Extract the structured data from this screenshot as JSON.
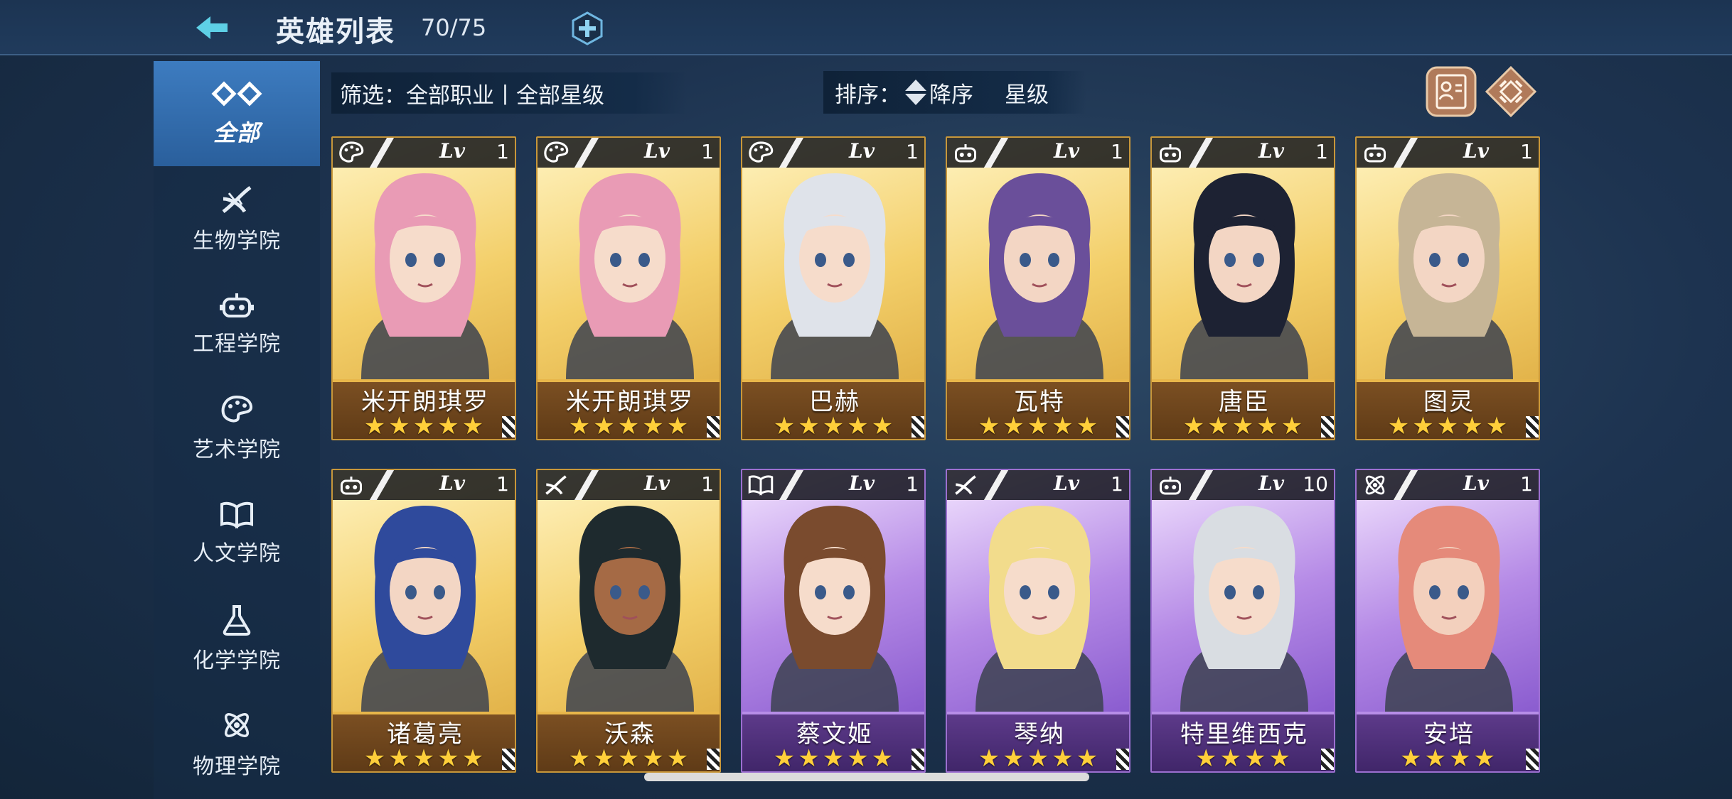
{
  "header": {
    "title": "英雄列表",
    "count": "70/75"
  },
  "sidebar": {
    "items": [
      {
        "label": "全部",
        "icon": "all-icon",
        "active": true
      },
      {
        "label": "生物学院",
        "icon": "dna-icon"
      },
      {
        "label": "工程学院",
        "icon": "robot-icon"
      },
      {
        "label": "艺术学院",
        "icon": "palette-icon"
      },
      {
        "label": "人文学院",
        "icon": "book-icon"
      },
      {
        "label": "化学学院",
        "icon": "flask-icon"
      },
      {
        "label": "物理学院",
        "icon": "atom-icon"
      }
    ]
  },
  "filter": {
    "text": "筛选：全部职业丨全部星级"
  },
  "sort": {
    "label": "排序：",
    "order": "降序",
    "field": "星级"
  },
  "lv_label": "Lv",
  "heroes": [
    {
      "name": "米开朗琪罗",
      "level": "1",
      "stars": "★★★★★",
      "stars_count": 5,
      "class_icon": "palette-icon",
      "rarity": "gold"
    },
    {
      "name": "米开朗琪罗",
      "level": "1",
      "stars": "★★★★★",
      "stars_count": 5,
      "class_icon": "palette-icon",
      "rarity": "gold"
    },
    {
      "name": "巴赫",
      "level": "1",
      "stars": "★★★★★",
      "stars_count": 5,
      "class_icon": "palette-icon",
      "rarity": "gold"
    },
    {
      "name": "瓦特",
      "level": "1",
      "stars": "★★★★★",
      "stars_count": 5,
      "class_icon": "robot-icon",
      "rarity": "gold"
    },
    {
      "name": "唐臣",
      "level": "1",
      "stars": "★★★★★",
      "stars_count": 5,
      "class_icon": "robot-icon",
      "rarity": "gold"
    },
    {
      "name": "图灵",
      "level": "1",
      "stars": "★★★★★",
      "stars_count": 5,
      "class_icon": "robot-icon",
      "rarity": "gold"
    },
    {
      "name": "诸葛亮",
      "level": "1",
      "stars": "★★★★★",
      "stars_count": 5,
      "class_icon": "robot-icon",
      "rarity": "gold"
    },
    {
      "name": "沃森",
      "level": "1",
      "stars": "★★★★★",
      "stars_count": 5,
      "class_icon": "dna-icon",
      "rarity": "gold"
    },
    {
      "name": "蔡文姬",
      "level": "1",
      "stars": "★★★★★",
      "stars_count": 5,
      "class_icon": "book-icon",
      "rarity": "purple"
    },
    {
      "name": "琴纳",
      "level": "1",
      "stars": "★★★★★",
      "stars_count": 5,
      "class_icon": "dna-icon",
      "rarity": "purple"
    },
    {
      "name": "特里维西克",
      "level": "10",
      "stars": "★★★★",
      "stars_count": 4,
      "class_icon": "robot-icon",
      "rarity": "purple"
    },
    {
      "name": "安培",
      "level": "1",
      "stars": "★★★★",
      "stars_count": 4,
      "class_icon": "atom-icon",
      "rarity": "purple"
    }
  ],
  "colors": {
    "gold_frame": "#c8973a",
    "purple_frame": "#9c6fd0",
    "star": "#ffcf3a",
    "active_tab": "#3d7cc0"
  }
}
